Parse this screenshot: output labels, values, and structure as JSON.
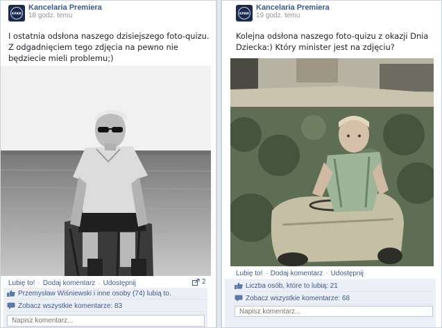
{
  "left": {
    "author": "Kancelaria Premiera",
    "time": "18 godz. temu",
    "avatar_text": "KPRM",
    "message": "I ostatnia odsłona naszego dzisiejszego foto-quizu. Z odgadnięciem tego zdjęcia na pewno nie będziecie mieli problemu;)",
    "actions": {
      "like": "Lubię to!",
      "comment": "Dodaj komentarz",
      "share": "Udostępnij"
    },
    "share_count": "2",
    "likes_text": "Przemysław Wiśniewski i inne osoby (74) lubią to.",
    "comments_text": "Zobacz wszystkie komentarze: 83",
    "comment_placeholder": "Napisz komentarz..."
  },
  "right": {
    "author": "Kancelaria Premiera",
    "time": "19 godz. temu",
    "avatar_text": "KPRM",
    "message": "Kolejna odsłona naszego foto-quizu z okazji Dnia Dziecka:) Który minister jest na zdjęciu?",
    "actions": {
      "like": "Lubię to!",
      "comment": "Dodaj komentarz",
      "share": "Udostępnij"
    },
    "likes_text": "Liczba osób, które to lubią: 21",
    "comments_text": "Zobacz wszystkie komentarze: 68",
    "comment_placeholder": "Napisz komentarz..."
  },
  "colors": {
    "link": "#3b5998",
    "ufi_bg": "#eceff5",
    "border": "#cdd3de"
  },
  "icons": {
    "like": "thumbs-up-icon",
    "comment": "speech-bubble-icon",
    "share": "share-icon"
  }
}
